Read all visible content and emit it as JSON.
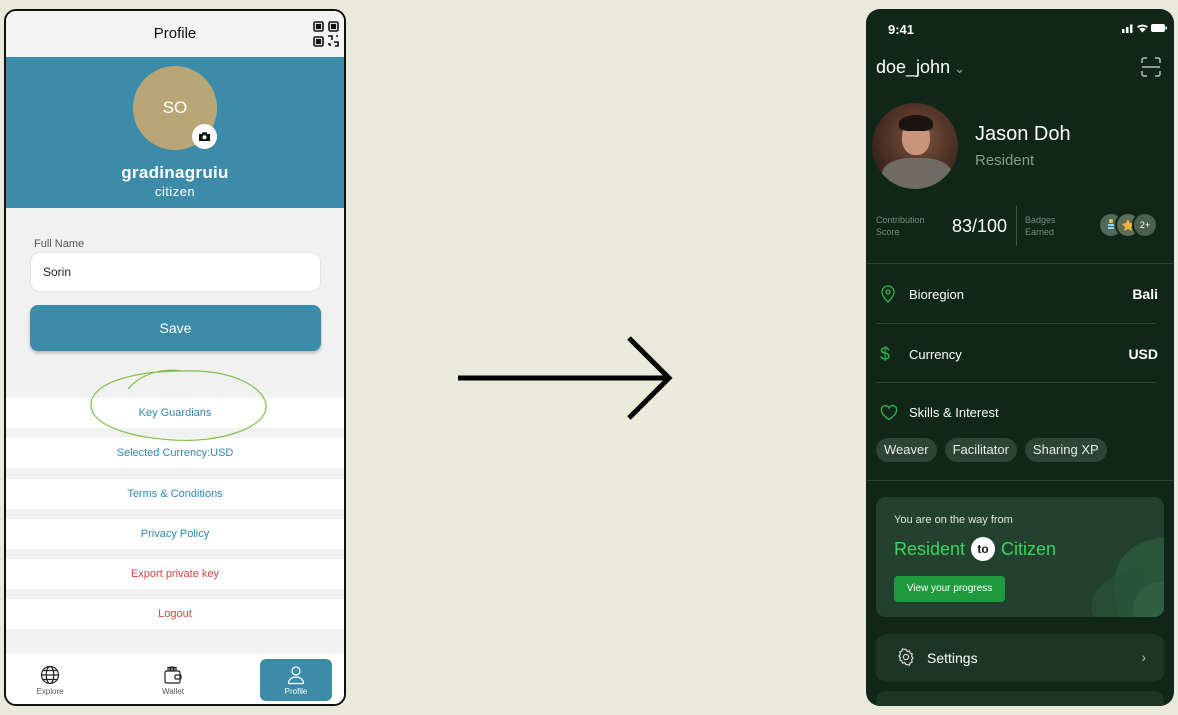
{
  "left": {
    "header": {
      "title": "Profile",
      "qr_icon": "qr-code-icon"
    },
    "profile": {
      "initials": "SO",
      "username": "gradinagruiu",
      "role": "citizen",
      "camera_icon": "camera-icon"
    },
    "form": {
      "full_name_label": "Full Name",
      "full_name_value": "Sorin",
      "save_label": "Save"
    },
    "links": [
      {
        "label": "Key Guardians"
      },
      {
        "label": "Selected Currency:USD"
      },
      {
        "label": "Terms & Conditions"
      },
      {
        "label": "Privacy Policy"
      },
      {
        "label": "Export private key"
      },
      {
        "label": "Logout"
      }
    ],
    "nav": [
      {
        "label": "Explore",
        "icon": "globe-icon"
      },
      {
        "label": "Wallet",
        "icon": "wallet-icon"
      },
      {
        "label": "Profile",
        "icon": "user-icon"
      }
    ],
    "colors": {
      "primary": "#3b8ba9",
      "avatar": "#b9a676",
      "link": "#2f88b3",
      "danger": "#d64545",
      "annotation": "#7ec04b"
    }
  },
  "right": {
    "status": {
      "time": "9:41"
    },
    "header": {
      "username": "doe_john",
      "scan_icon": "scan-icon"
    },
    "profile": {
      "name": "Jason Doh",
      "role": "Resident"
    },
    "stats": {
      "contribution_label_1": "Contribution",
      "contribution_label_2": "Score",
      "score": "83/100",
      "badges_label_1": "Badges",
      "badges_label_2": "Earned",
      "badges_more": "2+"
    },
    "rows": {
      "bioregion": {
        "label": "Bioregion",
        "value": "Bali",
        "icon": "location-pin-icon"
      },
      "currency": {
        "label": "Currency",
        "value": "USD",
        "icon": "dollar-icon"
      },
      "skills": {
        "label": "Skills & Interest",
        "icon": "heart-icon"
      }
    },
    "chips": [
      "Weaver",
      "Facilitator",
      "Sharing XP"
    ],
    "journey": {
      "intro": "You are on the way from",
      "from": "Resident",
      "to_word": "to",
      "to": "Citizen",
      "button": "View your progress"
    },
    "settings": {
      "label": "Settings",
      "icon": "gear-icon"
    },
    "colors": {
      "background": "#0f2618",
      "accent": "#3ed45e",
      "button": "#1f9b3e"
    }
  }
}
